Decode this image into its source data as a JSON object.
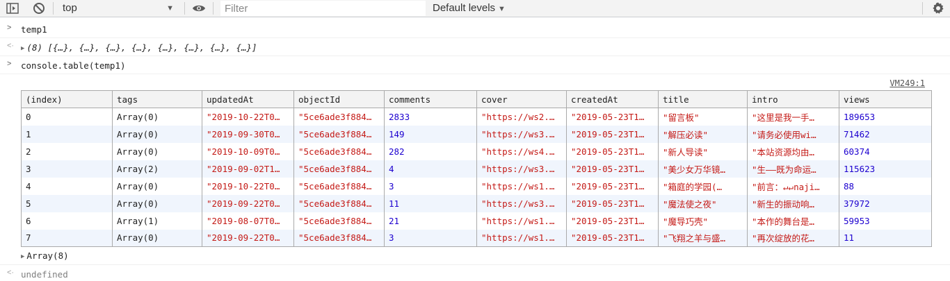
{
  "toolbar": {
    "context": "top",
    "filter_placeholder": "Filter",
    "levels_label": "Default levels"
  },
  "console": {
    "input1": "temp1",
    "output1_count": "(8)",
    "output1_value": "[{…}, {…}, {…}, {…}, {…}, {…}, {…}, {…}]",
    "input2": "console.table(temp1)",
    "source_link": "VM249:1",
    "array_summary": "Array(8)",
    "result": "undefined"
  },
  "table": {
    "headers": [
      "(index)",
      "tags",
      "updatedAt",
      "objectId",
      "comments",
      "cover",
      "createdAt",
      "title",
      "intro",
      "views"
    ],
    "rows": [
      [
        "0",
        "Array(0)",
        "\"2019-10-22T0…",
        "\"5ce6ade3f884…",
        "2833",
        "\"https://ws2.…",
        "\"2019-05-23T1…",
        "\"留言板\"",
        "\"这里是我一手…",
        "189653"
      ],
      [
        "1",
        "Array(0)",
        "\"2019-09-30T0…",
        "\"5ce6ade3f884…",
        "149",
        "\"https://ws3.…",
        "\"2019-05-23T1…",
        "\"解压必读\"",
        "\"请务必使用wi…",
        "71462"
      ],
      [
        "2",
        "Array(0)",
        "\"2019-10-09T0…",
        "\"5ce6ade3f884…",
        "282",
        "\"https://ws4.…",
        "\"2019-05-23T1…",
        "\"新人导读\"",
        "\"本站资源均由…",
        "60374"
      ],
      [
        "3",
        "Array(2)",
        "\"2019-09-02T1…",
        "\"5ce6ade3f884…",
        "4",
        "\"https://ws3.…",
        "\"2019-05-23T1…",
        "\"美少女万华镜…",
        "\"生——既为命运…",
        "115623"
      ],
      [
        "4",
        "Array(0)",
        "\"2019-10-22T0…",
        "\"5ce6ade3f884…",
        "3",
        "\"https://ws1.…",
        "\"2019-05-23T1…",
        "\"箱庭的学园(…",
        "\"前言：↵↵naji…",
        "88"
      ],
      [
        "5",
        "Array(0)",
        "\"2019-09-22T0…",
        "\"5ce6ade3f884…",
        "11",
        "\"https://ws3.…",
        "\"2019-05-23T1…",
        "\"魔法使之夜\"",
        "\"新生的振动响…",
        "37972"
      ],
      [
        "6",
        "Array(1)",
        "\"2019-08-07T0…",
        "\"5ce6ade3f884…",
        "21",
        "\"https://ws1.…",
        "\"2019-05-23T1…",
        "\"魔导巧壳\"",
        "\"本作的舞台是…",
        "59953"
      ],
      [
        "7",
        "Array(0)",
        "\"2019-09-22T0…",
        "\"5ce6ade3f884…",
        "3",
        "\"https://ws1.…",
        "\"2019-05-23T1…",
        "\"飞翔之羊与盛…",
        "\"再次绽放的花…",
        "11"
      ]
    ],
    "column_types": [
      "plain",
      "plain",
      "str",
      "str",
      "num",
      "str",
      "str",
      "str",
      "str",
      "num"
    ]
  },
  "colors": {
    "string": "#c41a16",
    "number": "#1c00cf",
    "row_stripe": "#f0f5fd",
    "toolbar_bg": "#f3f3f3"
  },
  "icons": [
    "sidebar-toggle-icon",
    "clear-console-icon",
    "dropdown-arrow-icon",
    "eye-icon",
    "settings-gear-icon",
    "expand-triangle-icon"
  ]
}
